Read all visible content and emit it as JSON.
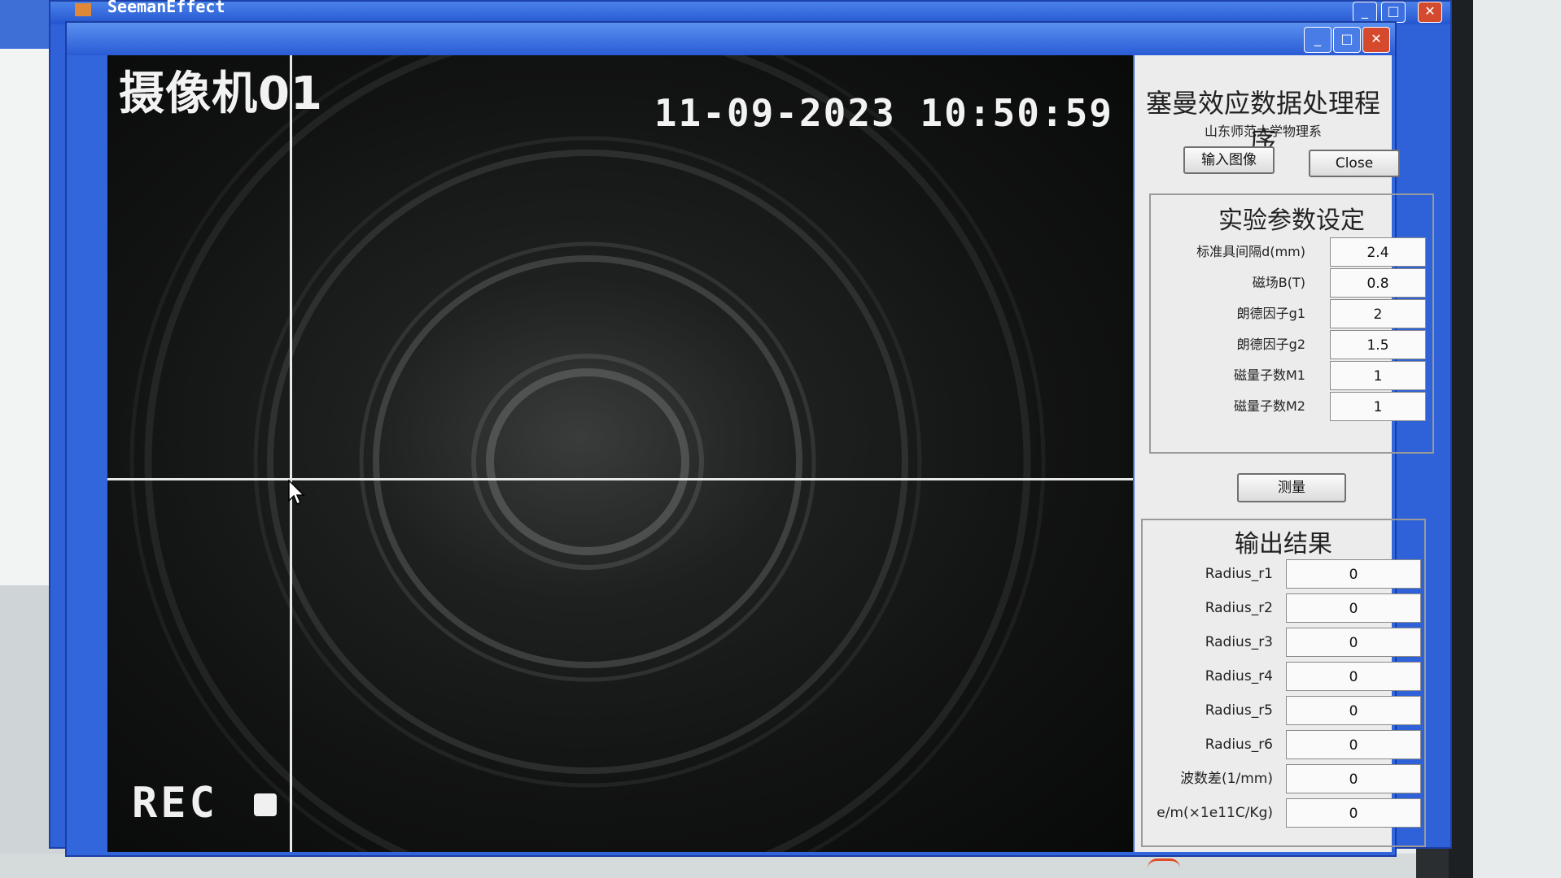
{
  "background_window": {
    "title": "SeemanEffect"
  },
  "camera": {
    "label": "摄像机01",
    "timestamp": "11-09-2023  10:50:59",
    "rec_label": "REC"
  },
  "app": {
    "title": "塞曼效应数据处理程序",
    "subtitle": "山东师范大学物理系",
    "input_image_button": "输入图像",
    "close_button": "Close",
    "measure_button": "测量"
  },
  "parameters": {
    "title": "实验参数设定",
    "rows": [
      {
        "label": "标准具间隔d(mm)",
        "value": "2.4"
      },
      {
        "label": "磁场B(T)",
        "value": "0.8"
      },
      {
        "label": "朗德因子g1",
        "value": "2"
      },
      {
        "label": "朗德因子g2",
        "value": "1.5"
      },
      {
        "label": "磁量子数M1",
        "value": "1"
      },
      {
        "label": "磁量子数M2",
        "value": "1"
      }
    ]
  },
  "output": {
    "title": "输出结果",
    "rows": [
      {
        "label": "Radius_r1",
        "value": "0"
      },
      {
        "label": "Radius_r2",
        "value": "0"
      },
      {
        "label": "Radius_r3",
        "value": "0"
      },
      {
        "label": "Radius_r4",
        "value": "0"
      },
      {
        "label": "Radius_r5",
        "value": "0"
      },
      {
        "label": "Radius_r6",
        "value": "0"
      },
      {
        "label": "波数差(1/mm)",
        "value": "0"
      },
      {
        "label": "e/m(×1e11C/Kg)",
        "value": "0"
      }
    ]
  },
  "colors": {
    "window_blue": "#3166dd",
    "close_red": "#d54a2c",
    "panel_bg": "#ececec",
    "camera_bg": "#0e0f10"
  },
  "icons": {
    "minimize": "minimize-icon",
    "maximize": "maximize-icon",
    "close": "close-icon",
    "cursor": "arrow-cursor-icon"
  }
}
